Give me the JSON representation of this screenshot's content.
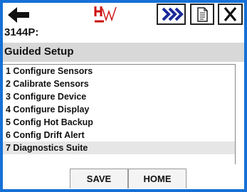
{
  "toolbar": {
    "back_icon": "arrow-left-icon",
    "logo_text": "HART",
    "next_icon": "double-chevron-right-icon",
    "doc_icon": "document-icon",
    "close_icon": "close-x-icon",
    "accent_color": "#1570d6",
    "logo_color": "#cc1111"
  },
  "device": {
    "tag": "3144P:"
  },
  "menu": {
    "title": "Guided Setup",
    "items": [
      {
        "label": "1 Configure Sensors"
      },
      {
        "label": "2 Calibrate Sensors"
      },
      {
        "label": "3 Configure Device"
      },
      {
        "label": "4 Configure Display"
      },
      {
        "label": "5 Config Hot Backup"
      },
      {
        "label": "6 Config Drift Alert"
      },
      {
        "label": "7 Diagnostics Suite"
      }
    ],
    "selected_index": 6
  },
  "footer": {
    "save_label": "SAVE",
    "home_label": "HOME"
  }
}
